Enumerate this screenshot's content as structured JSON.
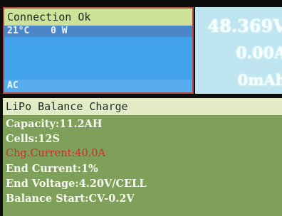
{
  "status": {
    "connection": "Connection Ok",
    "temperature": "21°C",
    "power": "0 W",
    "source": "AC"
  },
  "readings": {
    "voltage": "48.369V",
    "power": "0.00A",
    "current": "0mAh"
  },
  "program": {
    "title": "LiPo Balance Charge",
    "params": [
      {
        "text": "Capacity:11.2AH",
        "highlight": false
      },
      {
        "text": "Cells:12S",
        "highlight": false
      },
      {
        "text": "Chg.Current:40.0A",
        "highlight": true
      },
      {
        "text": "End Current:1%",
        "highlight": false
      },
      {
        "text": "End Voltage:4.20V/CELL",
        "highlight": false
      },
      {
        "text": "Balance Start:CV-0.2V",
        "highlight": false
      }
    ]
  },
  "colors": {
    "alert": "#d32b2b",
    "frame": "#b24a4a"
  }
}
